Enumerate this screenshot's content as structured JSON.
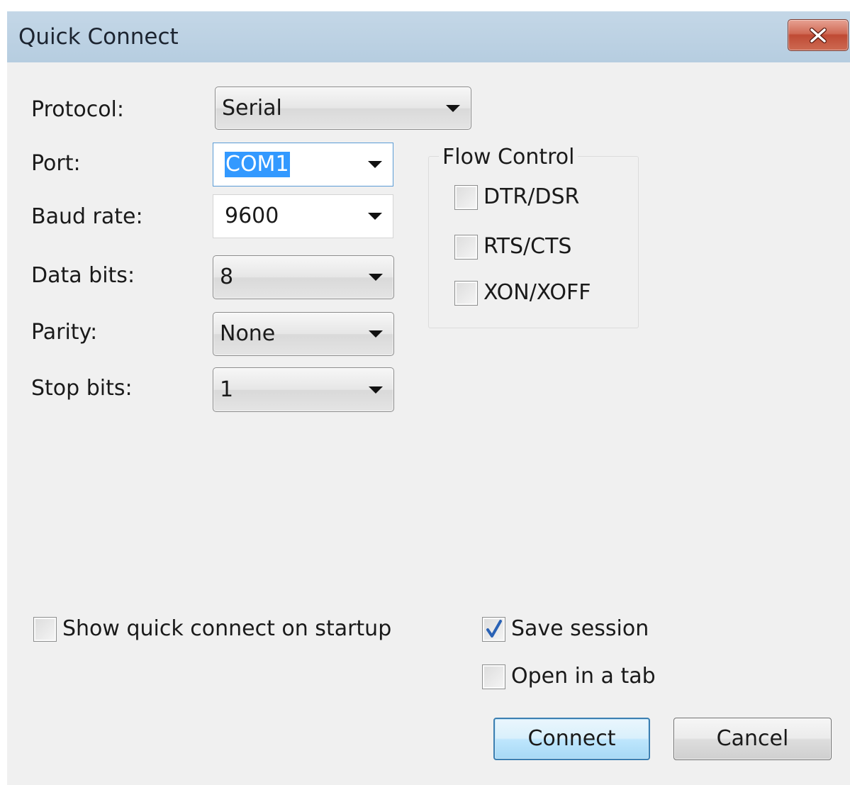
{
  "window": {
    "title": "Quick Connect",
    "close_label": "close"
  },
  "form": {
    "protocol": {
      "label": "Protocol:",
      "value": "Serial"
    },
    "port": {
      "label": "Port:",
      "value": "COM1"
    },
    "baud_rate": {
      "label": "Baud rate:",
      "value": "9600"
    },
    "data_bits": {
      "label": "Data bits:",
      "value": "8"
    },
    "parity": {
      "label": "Parity:",
      "value": "None"
    },
    "stop_bits": {
      "label": "Stop bits:",
      "value": "1"
    }
  },
  "flow_control": {
    "title": "Flow Control",
    "options": [
      {
        "label": "DTR/DSR",
        "checked": false
      },
      {
        "label": "RTS/CTS",
        "checked": false
      },
      {
        "label": "XON/XOFF",
        "checked": false
      }
    ]
  },
  "options": {
    "show_on_startup": {
      "label": "Show quick connect on startup",
      "checked": false
    },
    "save_session": {
      "label": "Save session",
      "checked": true
    },
    "open_in_tab": {
      "label": "Open in a tab",
      "checked": false
    }
  },
  "buttons": {
    "connect": "Connect",
    "cancel": "Cancel"
  },
  "colors": {
    "titlebar": "#b6cde0",
    "close_button": "#c9563f",
    "selection": "#3399ff",
    "default_button_border": "#3c7fb1",
    "check_mark": "#2a62b5"
  }
}
